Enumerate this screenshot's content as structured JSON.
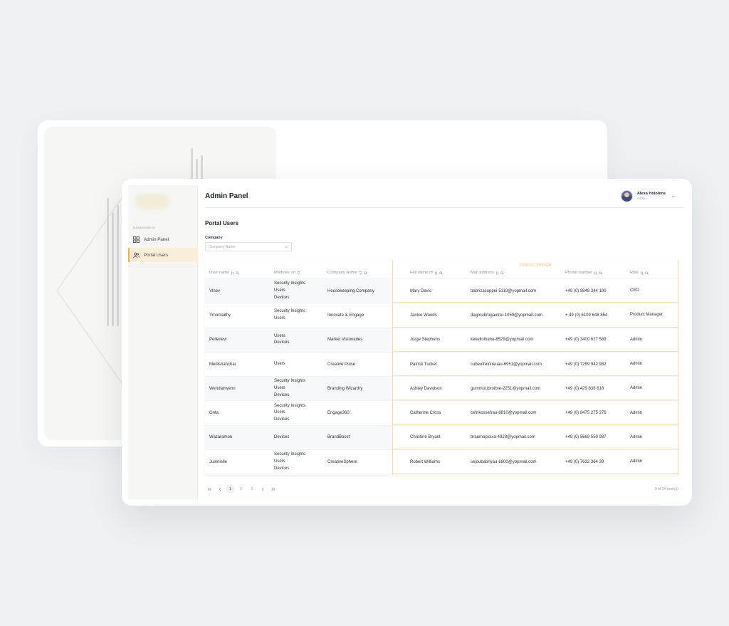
{
  "sidebar": {
    "section": "MANAGEMENT",
    "items": [
      {
        "label": "Admin Panel",
        "icon": "grid-icon"
      },
      {
        "label": "Portal Users",
        "icon": "users-icon"
      }
    ]
  },
  "header": {
    "title": "Admin Panel",
    "user_name": "Alexa Hololens",
    "user_role": "Admin"
  },
  "page": {
    "section_title": "Portal Users",
    "filter_label": "Company",
    "filter_placeholder": "Company Name"
  },
  "table": {
    "group_label": "CONTACT PERSON",
    "columns": [
      "User name",
      "Modules on",
      "Company Name",
      "Full name of",
      "Mail address",
      "Phone number",
      "Role"
    ],
    "rows": [
      {
        "username": "Vlnev",
        "modules": [
          "Security Insights",
          "Users",
          "Devices"
        ],
        "company": "Housekeeping Company",
        "fullname": "Mary Davis",
        "mail": "babrizacuppei-5119@yopmail.com",
        "phone": "+49 (0) 9848 344 190",
        "role": "CEO"
      },
      {
        "username": "Ymontaithy",
        "modules": [
          "Security Insights",
          "Users"
        ],
        "company": "Innovate & Engage",
        "fullname": "Janice Woods",
        "mail": "dagroubrogautrei-1059@yopmail.com",
        "phone": "+ 49 (0) 6109 648 854",
        "role": "Product Manager"
      },
      {
        "username": "Pellenevi",
        "modules": [
          "Users",
          "Devices"
        ],
        "company": "Market Visionaries",
        "fullname": "Jorge Stephens",
        "mail": "kekelloihaha-8529@yopmail.com",
        "phone": "+49 (0) 3400 627 589",
        "role": "Admin"
      },
      {
        "username": "Medishanchai",
        "modules": [
          "Users"
        ],
        "company": "Creative Pulse",
        "fullname": "Patrick Tucker",
        "mail": "cubeufreinneuau-6951@yopmail.com",
        "phone": "+49 (0) 7259 942 982",
        "role": "Admin"
      },
      {
        "username": "Wendairwenn",
        "modules": [
          "Security Insights",
          "Users",
          "Devices"
        ],
        "company": "Branding Wizardry",
        "fullname": "Ashley Davidson",
        "mail": "gummizubroibre-2251@yopmail.com",
        "phone": "+49 (0) 429 838 618",
        "role": "Admin"
      },
      {
        "username": "Onta",
        "modules": [
          "Security Insights",
          "Users",
          "Devices"
        ],
        "company": "Engage360",
        "fullname": "Catherine Cross",
        "mail": "cefrikossefrau-8810@yopmail.com",
        "phone": "+49 (0) 8475 275 376",
        "role": "Admin"
      },
      {
        "username": "Wazaramon",
        "modules": [
          "Devices"
        ],
        "company": "BrandBoost",
        "fullname": "Christine Bryant",
        "mail": "braumopisixa-4928@yopmail.com",
        "phone": "+49 (0) 5669 550 987",
        "role": "Admin"
      },
      {
        "username": "Juinnielle",
        "modules": [
          "Security Insights",
          "Users",
          "Devices"
        ],
        "company": "CreativeSphere",
        "fullname": "Robert Williams",
        "mail": "sejoubabriyau-6800@yopmail.com",
        "phone": "+49 (0) 7632 364 39",
        "role": "Admin"
      }
    ]
  },
  "pagination": {
    "pages": [
      "1",
      "2",
      "3"
    ],
    "active": "1",
    "count": "9 of 24 item(s)"
  },
  "colors": {
    "accent": "#f2b24a",
    "active_bg": "#fbeed9"
  }
}
